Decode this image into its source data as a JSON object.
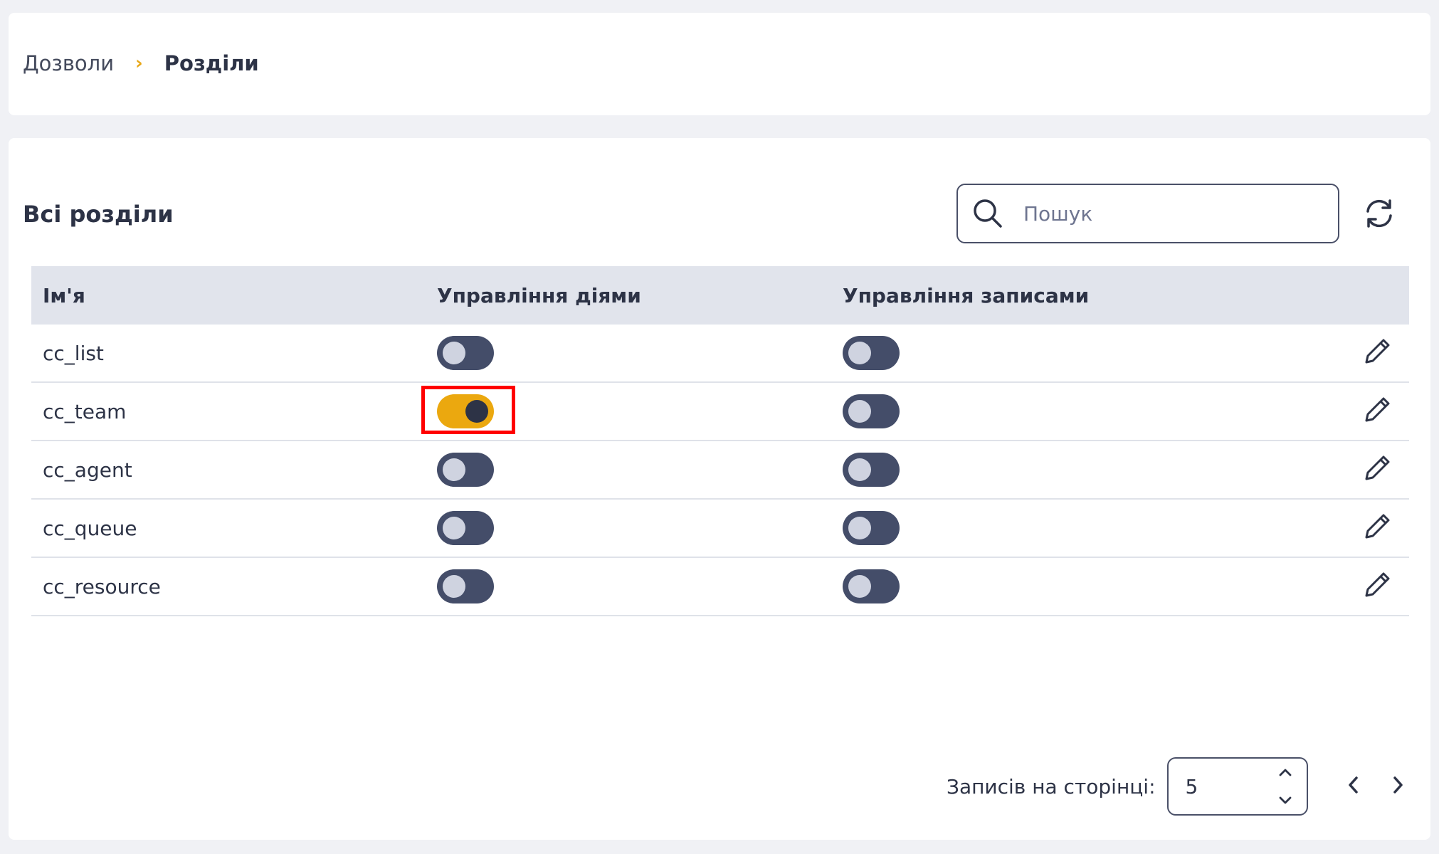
{
  "breadcrumb": {
    "items": [
      {
        "label": "Дозволи"
      },
      {
        "label": "Розділи"
      }
    ],
    "separator": "›"
  },
  "section": {
    "title": "Всі розділи"
  },
  "search": {
    "placeholder": "Пошук",
    "value": "",
    "icon": "search-icon"
  },
  "refresh": {
    "icon": "refresh-icon"
  },
  "table": {
    "columns": [
      "Ім'я",
      "Управління діями",
      "Управління записами"
    ],
    "rows": [
      {
        "name": "cc_list",
        "actions": false,
        "records": false
      },
      {
        "name": "cc_team",
        "actions": true,
        "records": false
      },
      {
        "name": "cc_agent",
        "actions": false,
        "records": false
      },
      {
        "name": "cc_queue",
        "actions": false,
        "records": false
      },
      {
        "name": "cc_resource",
        "actions": false,
        "records": false
      }
    ],
    "edit_icon": "pencil-icon"
  },
  "pagination": {
    "per_page_label": "Записів на сторінці:",
    "per_page_value": "5"
  },
  "colors": {
    "accent": "#eba80f",
    "switch_off": "#444d69",
    "text": "#2d3346",
    "highlight": "#ff0000"
  }
}
